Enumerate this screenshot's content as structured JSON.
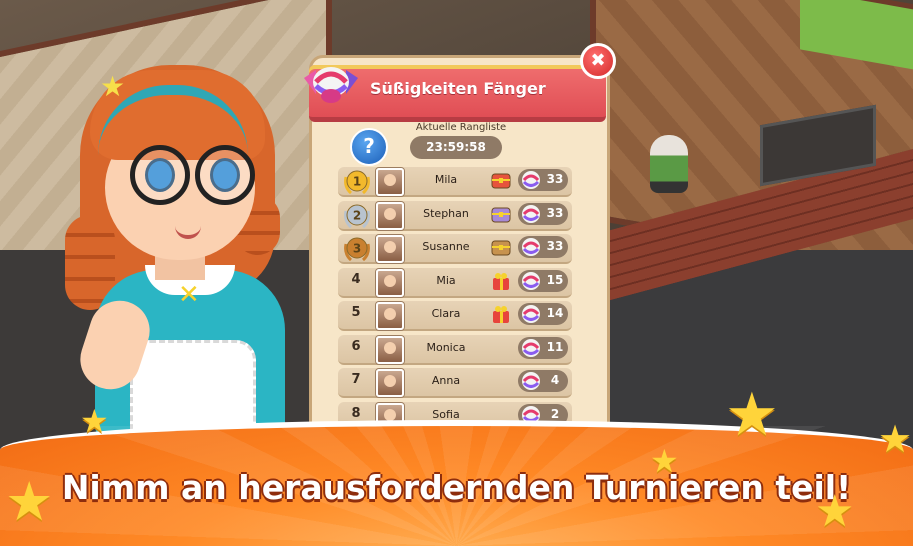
{
  "popup": {
    "title": "Süßigkeiten Fänger",
    "rank_title": "Aktuelle Rangliste",
    "timer": "23:59:58",
    "help_glyph": "?",
    "close_glyph": "✖"
  },
  "leaderboard": [
    {
      "rank": "1",
      "name": "Mila",
      "score": "33",
      "medal": "gold",
      "chest": "red"
    },
    {
      "rank": "2",
      "name": "Stephan",
      "score": "33",
      "medal": "silver",
      "chest": "purple"
    },
    {
      "rank": "3",
      "name": "Susanne",
      "score": "33",
      "medal": "bronze",
      "chest": "brown"
    },
    {
      "rank": "4",
      "name": "Mia",
      "score": "15",
      "medal": "",
      "chest": "gift"
    },
    {
      "rank": "5",
      "name": "Clara",
      "score": "14",
      "medal": "",
      "chest": "gift"
    },
    {
      "rank": "6",
      "name": "Monica",
      "score": "11",
      "medal": "",
      "chest": ""
    },
    {
      "rank": "7",
      "name": "Anna",
      "score": "4",
      "medal": "",
      "chest": ""
    },
    {
      "rank": "8",
      "name": "Sofia",
      "score": "2",
      "medal": "",
      "chest": ""
    }
  ],
  "banner": {
    "headline": "Nimm an herausfordernden Turnieren teil!"
  },
  "colors": {
    "title_red": "#e04e55",
    "panel_bg": "#f7e6c8",
    "banner_orange": "#ff8a26",
    "gold": "#f2b92c",
    "silver": "#b8c3cf",
    "bronze": "#c9802f"
  },
  "icons": {
    "candy": "candy-icon",
    "help": "help-icon",
    "close": "close-icon",
    "score": "candy-score-icon"
  }
}
